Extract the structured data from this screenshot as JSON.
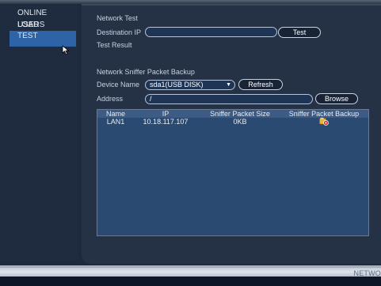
{
  "sidebar": {
    "items": [
      {
        "label": "ONLINE USERS"
      },
      {
        "label": "LOAD"
      },
      {
        "label": "TEST"
      }
    ]
  },
  "network_test": {
    "section_title": "Network Test",
    "destination_ip_label": "Destination IP",
    "destination_ip_value": "",
    "test_button": "Test",
    "test_result_label": "Test Result"
  },
  "sniffer": {
    "section_title": "Network Sniffer Packet Backup",
    "device_name_label": "Device Name",
    "device_name_value": "sda1(USB DISK)",
    "refresh_button": "Refresh",
    "address_label": "Address",
    "address_value": "/",
    "browse_button": "Browse",
    "table": {
      "headers": [
        "Name",
        "IP",
        "Sniffer Packet Size",
        "Sniffer Packet Backup"
      ],
      "rows": [
        {
          "name": "LAN1",
          "ip": "10.18.117.107",
          "size": "0KB",
          "backup_icon": "backup-icon"
        }
      ]
    }
  },
  "footer": {
    "label": "NETWO"
  },
  "colors": {
    "accent": "#2f63a8",
    "panel": "#253246",
    "table_bg": "#2b4a72"
  }
}
